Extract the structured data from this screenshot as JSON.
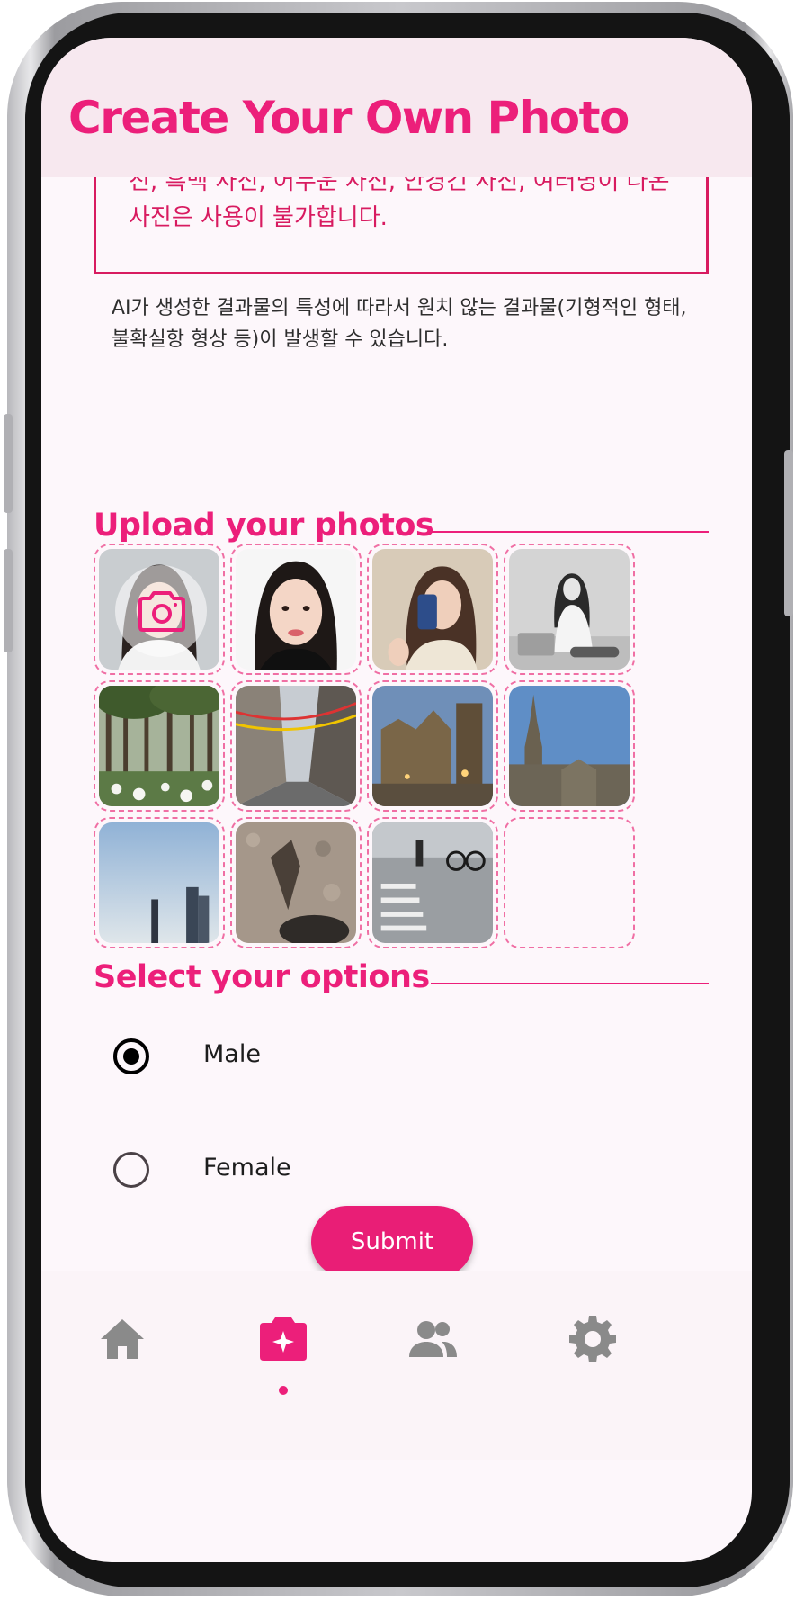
{
  "header": {
    "title": "Create Your Own Photo"
  },
  "notice": {
    "text": "진, 흑백 사진, 어두운 사진, 안경긴 사진, 여러명이 나온 사진은 사용이 불가합니다."
  },
  "disclaimer": "AI가 생성한 결과물의 특성에 따라서 원치 않는 결과물(기형적인 형태, 불확실항 형상 등)이 발생할 수 있습니다.",
  "upload": {
    "title": "Upload your photos"
  },
  "options": {
    "title": "Select your options",
    "gender": [
      {
        "label": "Male",
        "selected": true
      },
      {
        "label": "Female",
        "selected": false
      }
    ]
  },
  "submit_label": "Submit",
  "nav": {
    "items": [
      {
        "icon": "home-icon",
        "active": false
      },
      {
        "icon": "create-photo-icon",
        "active": true
      },
      {
        "icon": "people-icon",
        "active": false
      },
      {
        "icon": "settings-icon",
        "active": false
      }
    ]
  },
  "colors": {
    "accent": "#ec1f7a",
    "header_bg": "#f7e8ef",
    "screen_bg": "#fdf7fb",
    "nav_inactive": "#8a8a8a"
  }
}
